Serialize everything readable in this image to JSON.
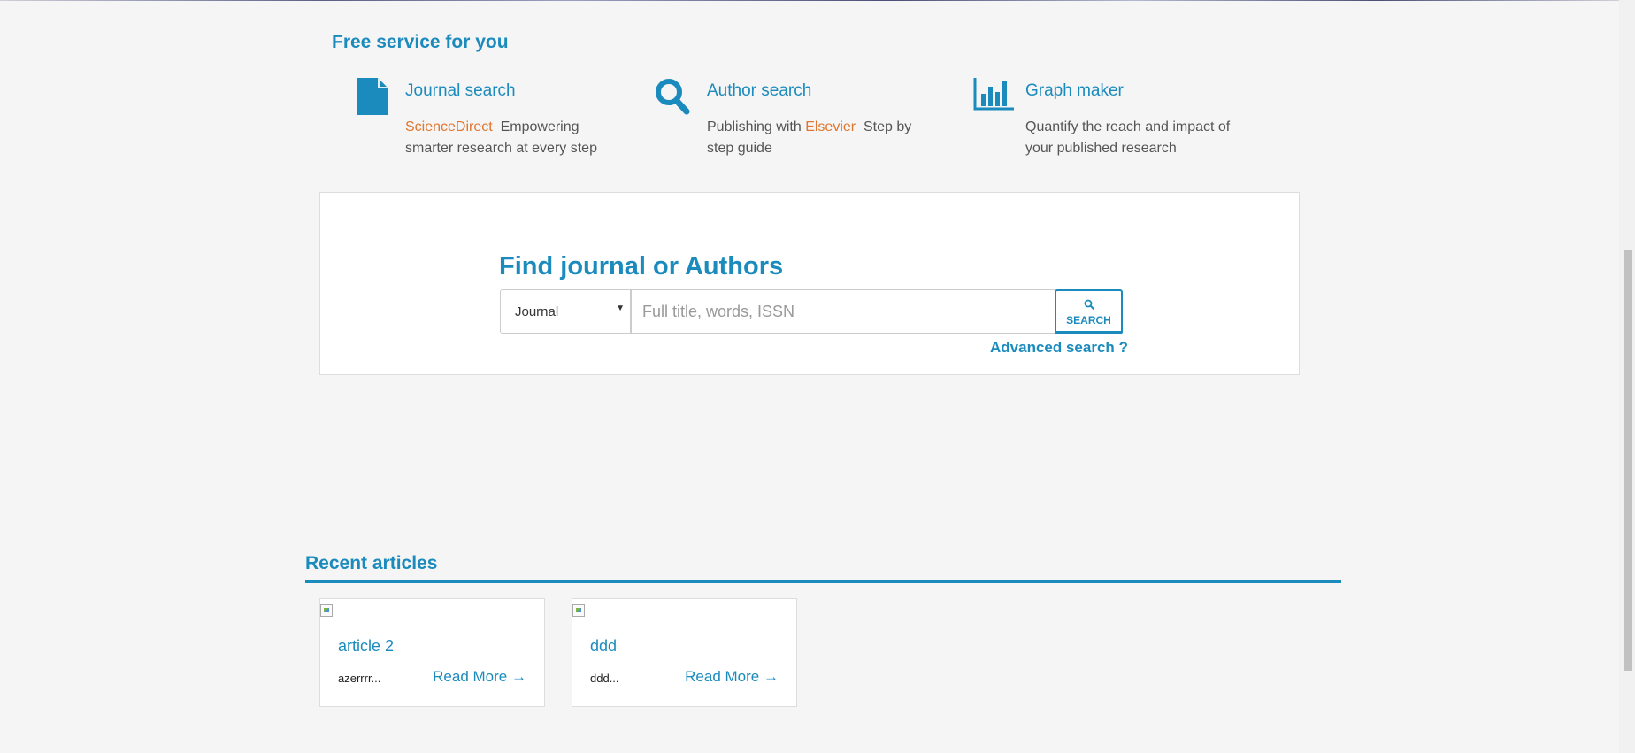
{
  "colors": {
    "accent": "#1b8bbd",
    "highlight": "#e0762d",
    "background": "#f5f5f5"
  },
  "services": {
    "heading": "Free service for you",
    "items": [
      {
        "icon": "document-icon",
        "title": "Journal search",
        "highlight": "ScienceDirect",
        "prefix": "",
        "text": "Empowering smarter research at every step"
      },
      {
        "icon": "search-icon",
        "title": "Author search",
        "prefix": "Publishing with",
        "highlight": "Elsevier",
        "text": "Step by step guide"
      },
      {
        "icon": "bar-chart-icon",
        "title": "Graph maker",
        "prefix": "",
        "highlight": "",
        "text": "Quantify the reach and impact of your published research"
      }
    ]
  },
  "search": {
    "heading": "Find journal or Authors",
    "type_selected": "Journal",
    "placeholder": "Full title, words, ISSN",
    "value": "",
    "button_label": "SEARCH",
    "advanced_label": "Advanced search ?"
  },
  "recent": {
    "heading": "Recent articles",
    "read_more": "Read More",
    "articles": [
      {
        "title": "article 2",
        "excerpt": "azerrrr..."
      },
      {
        "title": "ddd",
        "excerpt": "ddd..."
      }
    ]
  }
}
